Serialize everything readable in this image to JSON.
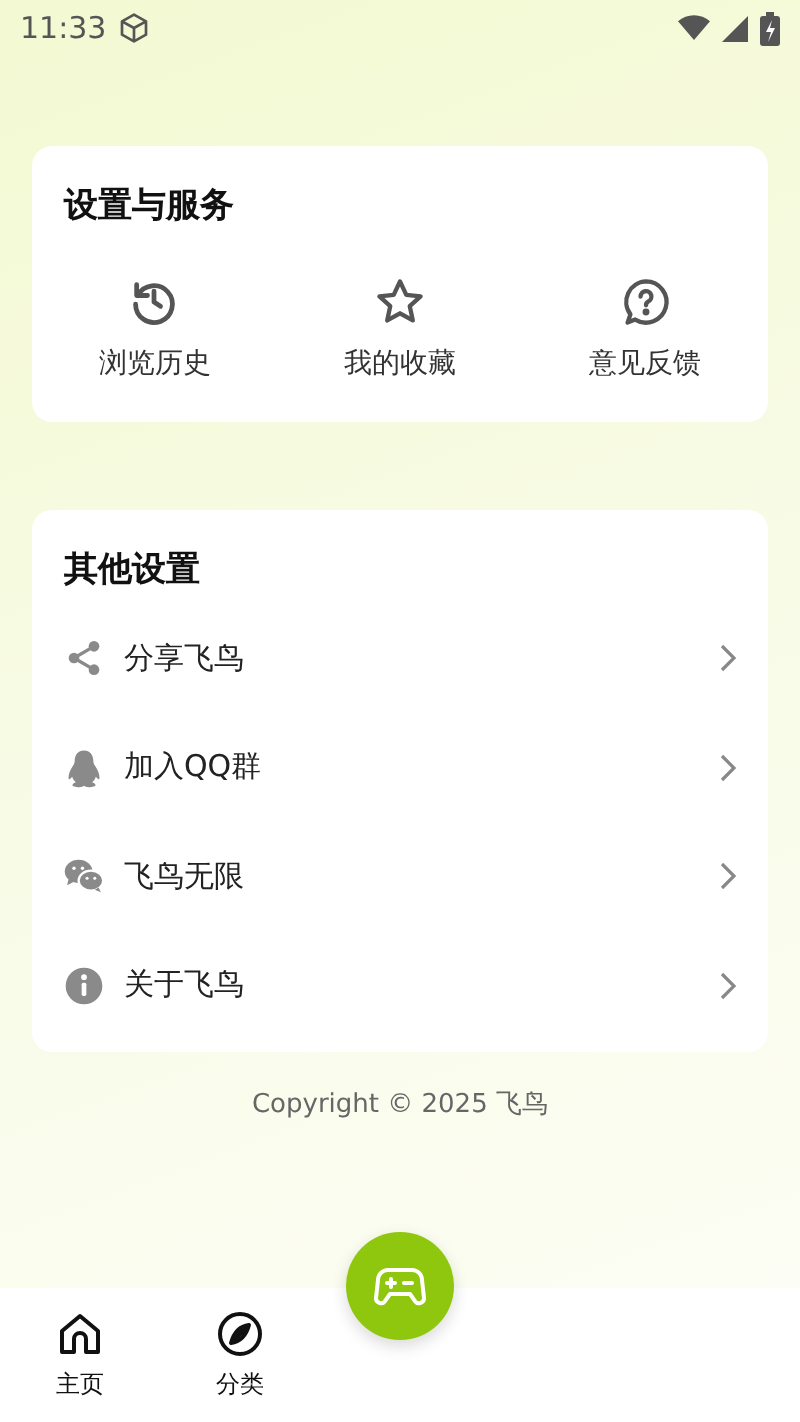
{
  "status_bar": {
    "time": "11:33"
  },
  "services": {
    "title": "设置与服务",
    "items": [
      {
        "label": "浏览历史"
      },
      {
        "label": "我的收藏"
      },
      {
        "label": "意见反馈"
      }
    ]
  },
  "other_settings": {
    "title": "其他设置",
    "items": [
      {
        "label": "分享飞鸟"
      },
      {
        "label": "加入QQ群"
      },
      {
        "label": "飞鸟无限"
      },
      {
        "label": "关于飞鸟"
      }
    ]
  },
  "footer": {
    "copyright": "Copyright © 2025 飞鸟"
  },
  "bottom_nav": {
    "items": [
      {
        "label": "主页"
      },
      {
        "label": "分类"
      }
    ]
  }
}
